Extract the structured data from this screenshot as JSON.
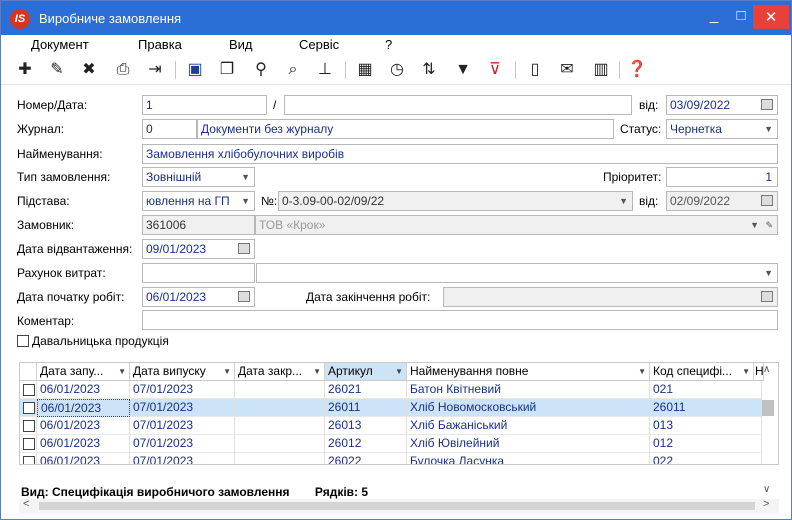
{
  "window": {
    "title": "Виробниче замовлення",
    "logo": "IS",
    "minimize": "_",
    "maximize": "□",
    "close": "✕"
  },
  "menu": [
    "Документ",
    "Правка",
    "Вид",
    "Сервіс",
    "?"
  ],
  "toolbar_icons": [
    "add-doc-icon",
    "edit-doc-icon",
    "delete-doc-icon",
    "print-icon",
    "export-icon",
    "save-icon",
    "copy-icon",
    "search-icon",
    "find-next-icon",
    "hierarchy-icon",
    "grid-icon",
    "clock-icon",
    "sort-icon",
    "filter-icon",
    "clear-filter-icon",
    "form-icon",
    "mail-icon",
    "columns-icon",
    "help-icon"
  ],
  "form": {
    "number_label": "Номер/Дата:",
    "number": "1",
    "slash": "/",
    "date_from_label": "від:",
    "date": "03/09/2022",
    "journal_label": "Журнал:",
    "journal_code": "0",
    "journal_name": "Документи без журналу",
    "status_label": "Статус:",
    "status": "Чернетка",
    "name_label": "Найменування:",
    "name": "Замовлення хлібобулочних виробів",
    "order_type_label": "Тип замовлення:",
    "order_type": "Зовнішній",
    "priority_label": "Пріоритет:",
    "priority": "1",
    "basis_label": "Підстава:",
    "basis": "ювлення на ГП",
    "basis_no_label": "№:",
    "basis_no": "0-3.09-00-02/09/22",
    "basis_date_label": "від:",
    "basis_date": "02/09/2022",
    "customer_label": "Замовник:",
    "customer_code": "361006",
    "customer_name": "ТОВ «Крок»",
    "ship_date_label": "Дата відвантаження:",
    "ship_date": "09/01/2023",
    "cost_account_label": "Рахунок витрат:",
    "start_date_label": "Дата початку робіт:",
    "start_date": "06/01/2023",
    "end_date_label": "Дата закінчення робіт:",
    "comment_label": "Коментар:",
    "tolling_label": "Давальницька продукція"
  },
  "table": {
    "columns": [
      "Дата запу...",
      "Дата випуску",
      "Дата закр...",
      "Артикул",
      "Найменування повне",
      "Код специфі...",
      "Н"
    ],
    "rows": [
      {
        "launch": "06/01/2023",
        "release": "07/01/2023",
        "close": "",
        "article": "26021",
        "name": "Батон Квітневий",
        "spec": "021"
      },
      {
        "launch": "06/01/2023",
        "release": "07/01/2023",
        "close": "",
        "article": "26011",
        "name": "Хліб Новомосковський",
        "spec": "26011"
      },
      {
        "launch": "06/01/2023",
        "release": "07/01/2023",
        "close": "",
        "article": "26013",
        "name": "Хліб Бажаніський",
        "spec": "013"
      },
      {
        "launch": "06/01/2023",
        "release": "07/01/2023",
        "close": "",
        "article": "26012",
        "name": "Хліб Ювілейний",
        "spec": "012"
      },
      {
        "launch": "06/01/2023",
        "release": "07/01/2023",
        "close": "",
        "article": "26022",
        "name": "Булочка Ласунка",
        "spec": "022"
      }
    ]
  },
  "status_bar": {
    "view": "Вид: Специфікація виробничого замовлення",
    "rows": "Рядків: 5"
  }
}
